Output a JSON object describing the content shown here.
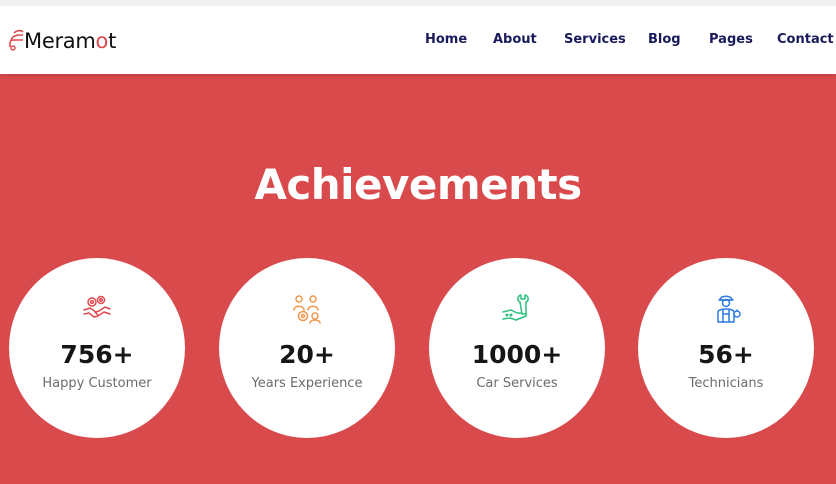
{
  "brand": {
    "name_start": "Meram",
    "name_accent": "o",
    "name_end": "t",
    "accent_color": "#e0494d"
  },
  "nav": {
    "items": [
      {
        "label": "Home"
      },
      {
        "label": "About"
      },
      {
        "label": "Services"
      },
      {
        "label": "Blog"
      },
      {
        "label": "Pages"
      },
      {
        "label": "Contact"
      }
    ],
    "color": "#1a1a5c"
  },
  "section": {
    "title": "Achievements",
    "background": "#d94a4c"
  },
  "stats": [
    {
      "value": "756+",
      "label": "Happy Customer",
      "icon": "handshake-gears-icon",
      "icon_color": "#e0494d"
    },
    {
      "value": "20+",
      "label": "Years Experience",
      "icon": "team-gear-icon",
      "icon_color": "#f0964a"
    },
    {
      "value": "1000+",
      "label": "Car Services",
      "icon": "wrench-hand-icon",
      "icon_color": "#2fbf7f"
    },
    {
      "value": "56+",
      "label": "Technicians",
      "icon": "mechanic-icon",
      "icon_color": "#2c7be5"
    }
  ]
}
